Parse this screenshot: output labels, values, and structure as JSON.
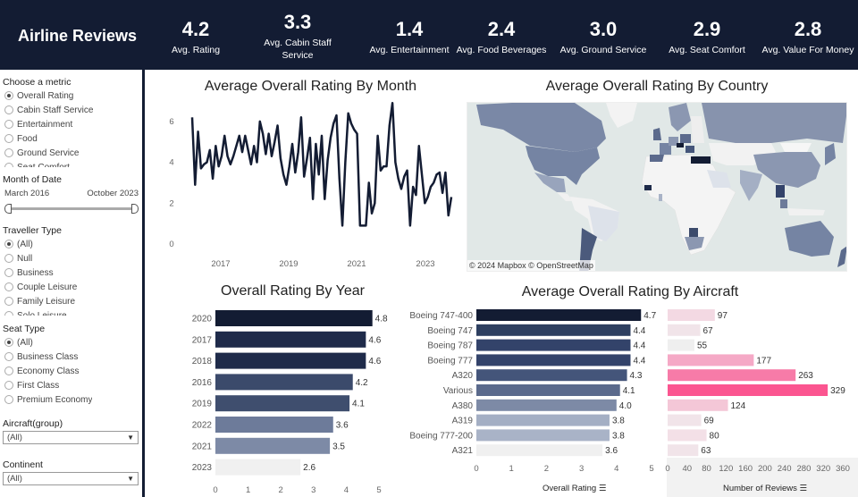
{
  "header": {
    "title": "Airline Reviews",
    "kpis": [
      {
        "value": "4.2",
        "label": "Avg. Rating"
      },
      {
        "value": "3.3",
        "label": "Avg. Cabin Staff Service"
      },
      {
        "value": "1.4",
        "label": "Avg. Entertainment"
      },
      {
        "value": "2.4",
        "label": "Avg. Food Beverages"
      },
      {
        "value": "3.0",
        "label": "Avg. Ground Service"
      },
      {
        "value": "2.9",
        "label": "Avg. Seat Comfort"
      },
      {
        "value": "2.8",
        "label": "Avg. Value For Money"
      }
    ]
  },
  "sidebar": {
    "metric": {
      "title": "Choose a metric",
      "options": [
        "Overall Rating",
        "Cabin Staff Service",
        "Entertainment",
        "Food",
        "Ground Service",
        "Seat Comfort"
      ],
      "selected": 0
    },
    "date": {
      "title": "Month of Date",
      "start": "March 2016",
      "end": "October 2023"
    },
    "traveller": {
      "title": "Traveller Type",
      "options": [
        "(All)",
        "Null",
        "Business",
        "Couple Leisure",
        "Family Leisure",
        "Solo Leisure"
      ],
      "selected": 0
    },
    "seat": {
      "title": "Seat Type",
      "options": [
        "(All)",
        "Business Class",
        "Economy Class",
        "First Class",
        "Premium Economy"
      ],
      "selected": 0
    },
    "aircraft": {
      "title": "Aircraft(group)",
      "value": "(All)"
    },
    "continent": {
      "title": "Continent",
      "value": "(All)"
    }
  },
  "map": {
    "title": "Average Overall Rating By Country",
    "attribution": "© 2024 Mapbox  © OpenStreetMap"
  },
  "chart_data": [
    {
      "type": "line",
      "title": "Average Overall Rating By Month",
      "xlabel": "",
      "ylabel": "",
      "x_ticks": [
        "2017",
        "2019",
        "2021",
        "2023"
      ],
      "y_ticks": [
        0,
        2,
        4,
        6
      ],
      "ylim": [
        0,
        7
      ],
      "x_range": [
        "2016-03",
        "2023-10"
      ],
      "color": "#131c33",
      "values": [
        6.2,
        2.9,
        5.5,
        3.7,
        3.9,
        4.0,
        4.6,
        3.2,
        4.8,
        3.8,
        4.3,
        5.3,
        4.3,
        3.9,
        4.3,
        4.8,
        5.3,
        4.5,
        5.3,
        4.6,
        3.9,
        4.8,
        4.0,
        6.0,
        5.4,
        4.4,
        5.4,
        4.3,
        5.0,
        5.8,
        4.2,
        3.4,
        2.9,
        3.8,
        4.9,
        3.5,
        4.5,
        6.2,
        3.3,
        4.2,
        5.2,
        2.2,
        4.9,
        3.4,
        5.3,
        2.2,
        4.1,
        5.2,
        5.9,
        6.3,
        3.2,
        0.9,
        4.0,
        6.4,
        5.9,
        5.6,
        5.4,
        0.9,
        0.9,
        0.9,
        3.0,
        1.5,
        2.0,
        5.3,
        3.6,
        3.8,
        3.8,
        5.8,
        6.9,
        4.0,
        3.2,
        2.7,
        3.3,
        3.6,
        0.9,
        2.8,
        2.4,
        4.8,
        3.4,
        2.0,
        2.3,
        2.8,
        3.0,
        3.4,
        3.5,
        2.5,
        3.5,
        1.4,
        2.3
      ]
    },
    {
      "type": "bar",
      "title": "Overall Rating By Year",
      "categories": [
        "2020",
        "2017",
        "2018",
        "2016",
        "2019",
        "2022",
        "2021",
        "2023"
      ],
      "values": [
        4.8,
        4.6,
        4.6,
        4.2,
        4.1,
        3.6,
        3.5,
        2.6
      ],
      "colors": [
        "#131c33",
        "#1f2b4a",
        "#1f2b4a",
        "#3b4a6b",
        "#3f4e6e",
        "#6d7b9a",
        "#7d8aa6",
        "#f0f0f0"
      ],
      "x_ticks": [
        0,
        1,
        2,
        3,
        4,
        5
      ],
      "xlim": [
        0,
        5
      ],
      "xlabel": "",
      "ylabel": ""
    },
    {
      "type": "bar",
      "title": "Average Overall Rating By Aircraft",
      "categories": [
        "Boeing 747-400",
        "Boeing 747",
        "Boeing 787",
        "Boeing 777",
        "A320",
        "Various",
        "A380",
        "A319",
        "Boeing 777-200",
        "A321"
      ],
      "values": [
        4.7,
        4.4,
        4.4,
        4.4,
        4.3,
        4.1,
        4.0,
        3.8,
        3.8,
        3.6
      ],
      "colors": [
        "#131c33",
        "#2e3f60",
        "#33436a",
        "#33436a",
        "#44557a",
        "#5b6a8c",
        "#7d8aa6",
        "#a4afc4",
        "#a9b3c7",
        "#f0f0f0"
      ],
      "x_ticks": [
        0,
        1,
        2,
        3,
        4,
        5
      ],
      "xlim": [
        0,
        5
      ],
      "xlabel": "Overall Rating",
      "ylabel": ""
    },
    {
      "type": "bar",
      "title": "",
      "categories": [
        "Boeing 747-400",
        "Boeing 747",
        "Boeing 787",
        "Boeing 777",
        "A320",
        "Various",
        "A380",
        "A319",
        "Boeing 777-200",
        "A321"
      ],
      "values": [
        97,
        67,
        55,
        177,
        263,
        329,
        124,
        69,
        80,
        63
      ],
      "colors": [
        "#f3d9e3",
        "#f1e4e9",
        "#efefef",
        "#f5a9c6",
        "#f77ba8",
        "#fb5590",
        "#f4c7d7",
        "#f1e4e9",
        "#f3e0e7",
        "#f1e4e9"
      ],
      "x_ticks": [
        0,
        40,
        80,
        120,
        160,
        200,
        240,
        280,
        320,
        360
      ],
      "xlim": [
        0,
        360
      ],
      "xlabel": "Number of Reviews",
      "ylabel": ""
    }
  ]
}
